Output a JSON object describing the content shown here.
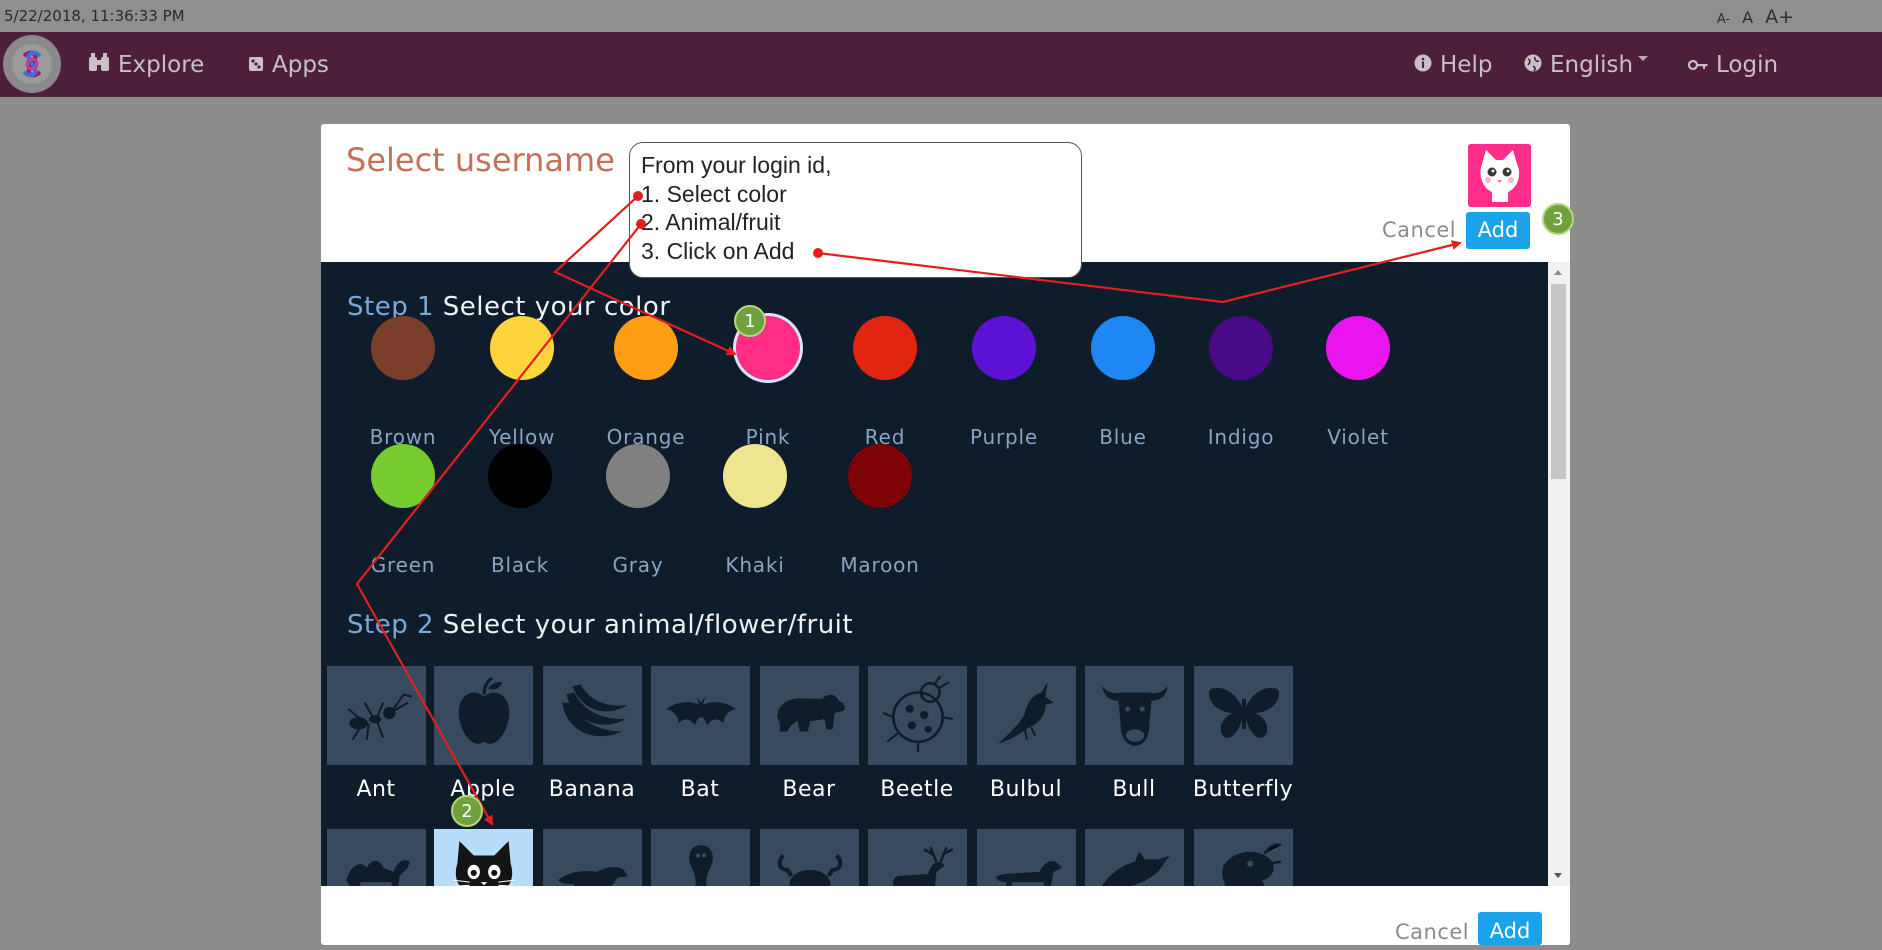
{
  "topbar": {
    "timestamp": "5/22/2018, 11:36:33 PM",
    "font_small": "A-",
    "font_normal": "A",
    "font_large": "A+"
  },
  "navbar": {
    "explore": "Explore",
    "apps": "Apps",
    "help": "Help",
    "language": "English",
    "login": "Login"
  },
  "modal": {
    "title": "Select username",
    "cancel_label": "Cancel",
    "add_label": "Add",
    "step1_num": "Step 1",
    "step1_text": "Select your color",
    "step2_num": "Step 2",
    "step2_text": "Select your animal/flower/fruit",
    "selected_color": "Pink",
    "selected_item": "Cat"
  },
  "callout": {
    "line1": "From your login id,",
    "line2": "1. Select color",
    "line3": "2. Animal/fruit",
    "line4": "3. Click on Add"
  },
  "badges": {
    "b1": "1",
    "b2": "2",
    "b3": "3"
  },
  "colors": [
    {
      "name": "Brown",
      "hex": "#7a3e2a"
    },
    {
      "name": "Yellow",
      "hex": "#fdd43b"
    },
    {
      "name": "Orange",
      "hex": "#fe9d14"
    },
    {
      "name": "Pink",
      "hex": "#ff2d85"
    },
    {
      "name": "Red",
      "hex": "#e22510"
    },
    {
      "name": "Purple",
      "hex": "#5e12d6"
    },
    {
      "name": "Blue",
      "hex": "#1e87f4"
    },
    {
      "name": "Indigo",
      "hex": "#4a0a87"
    },
    {
      "name": "Violet",
      "hex": "#ea14ee"
    },
    {
      "name": "Green",
      "hex": "#76cb2e"
    },
    {
      "name": "Black",
      "hex": "#000000"
    },
    {
      "name": "Gray",
      "hex": "#808080"
    },
    {
      "name": "Khaki",
      "hex": "#f0e48e"
    },
    {
      "name": "Maroon",
      "hex": "#7d0307"
    }
  ],
  "items": [
    {
      "name": "Ant",
      "icon": "ant-icon"
    },
    {
      "name": "Apple",
      "icon": "apple-icon"
    },
    {
      "name": "Banana",
      "icon": "banana-icon"
    },
    {
      "name": "Bat",
      "icon": "bat-icon"
    },
    {
      "name": "Bear",
      "icon": "bear-icon"
    },
    {
      "name": "Beetle",
      "icon": "beetle-icon"
    },
    {
      "name": "Bulbul",
      "icon": "bulbul-icon"
    },
    {
      "name": "Bull",
      "icon": "bull-icon"
    },
    {
      "name": "Butterfly",
      "icon": "butterfly-icon"
    }
  ],
  "items_row2": [
    {
      "icon": "camel-icon"
    },
    {
      "icon": "cat-icon"
    },
    {
      "icon": "cheetah-icon"
    },
    {
      "icon": "cobra-icon"
    },
    {
      "icon": "crab-icon"
    },
    {
      "icon": "deer-icon"
    },
    {
      "icon": "dog-icon"
    },
    {
      "icon": "dolphin-icon"
    },
    {
      "icon": "dragon-icon"
    }
  ],
  "theme": {
    "navbar": "#4d1f3b",
    "panel": "#0f1c2b",
    "accent": "#1aa3e8",
    "title": "#c5715a",
    "annotation": "#e02020",
    "badge": "#70a13e"
  }
}
